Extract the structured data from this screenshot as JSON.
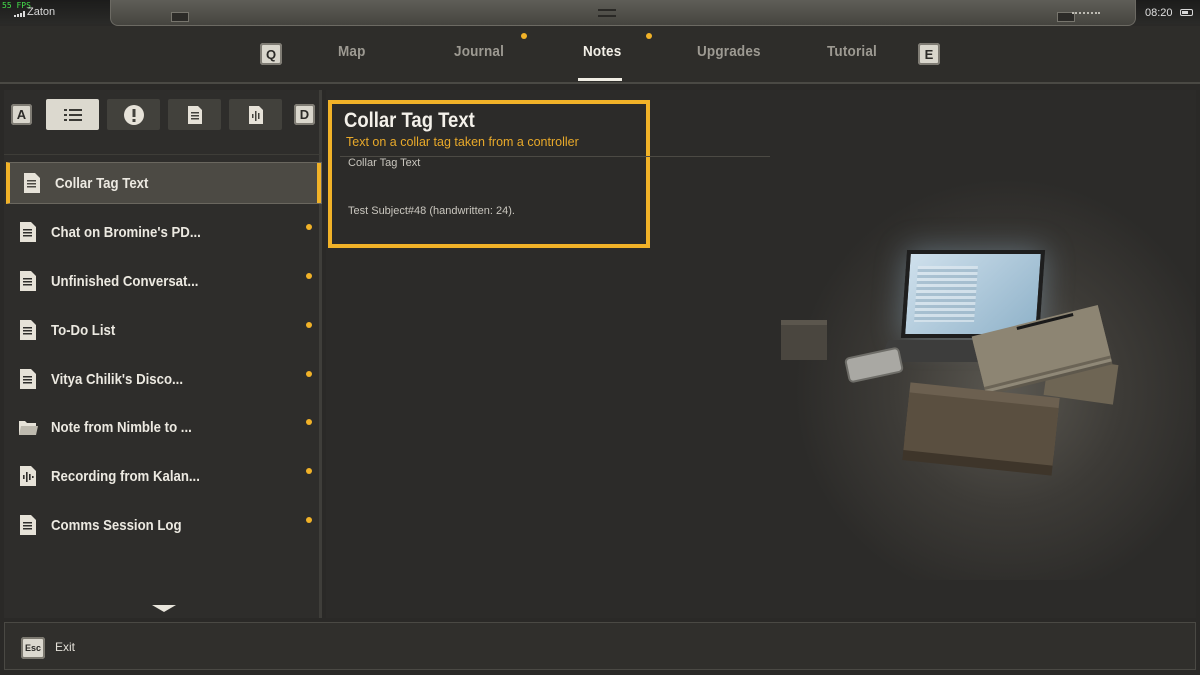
{
  "status": {
    "fps": "55 FPS",
    "location": "Zaton",
    "time": "08:20"
  },
  "tabs": {
    "prev_key": "Q",
    "next_key": "E",
    "items": [
      {
        "label": "Map",
        "active": false,
        "has_notification": false
      },
      {
        "label": "Journal",
        "active": false,
        "has_notification": true
      },
      {
        "label": "Notes",
        "active": true,
        "has_notification": false
      },
      {
        "label": "Upgrades",
        "active": false,
        "has_notification": true
      },
      {
        "label": "Tutorial",
        "active": false,
        "has_notification": false
      }
    ]
  },
  "filters": {
    "prev_key": "A",
    "next_key": "D",
    "buttons": [
      {
        "icon": "list-icon",
        "selected": true
      },
      {
        "icon": "exclamation-icon",
        "selected": false
      },
      {
        "icon": "document-icon",
        "selected": false
      },
      {
        "icon": "audio-document-icon",
        "selected": false
      }
    ]
  },
  "notes": [
    {
      "label": "Collar Tag Text",
      "icon": "document-icon",
      "unread": false,
      "active": true
    },
    {
      "label": "Chat on Bromine's PD...",
      "icon": "document-icon",
      "unread": true,
      "active": false
    },
    {
      "label": "Unfinished Conversat...",
      "icon": "document-icon",
      "unread": true,
      "active": false
    },
    {
      "label": "To-Do List",
      "icon": "document-icon",
      "unread": true,
      "active": false
    },
    {
      "label": "Vitya Chilik's Disco...",
      "icon": "document-icon",
      "unread": true,
      "active": false
    },
    {
      "label": "Note from Nimble to ...",
      "icon": "folder-icon",
      "unread": true,
      "active": false
    },
    {
      "label": "Recording from Kalan...",
      "icon": "audio-document-icon",
      "unread": true,
      "active": false
    },
    {
      "label": "Comms Session Log",
      "icon": "document-icon",
      "unread": true,
      "active": false
    }
  ],
  "detail": {
    "title": "Collar Tag Text",
    "subtitle": "Text on a collar tag taken from a controller",
    "line1": "Collar Tag Text",
    "line2": "Test Subject#48 (handwritten: 24)."
  },
  "footer": {
    "esc_key": "Esc",
    "exit_label": "Exit"
  },
  "colors": {
    "accent": "#f1b228",
    "background": "#2c2b29",
    "text": "#ece9e1"
  }
}
